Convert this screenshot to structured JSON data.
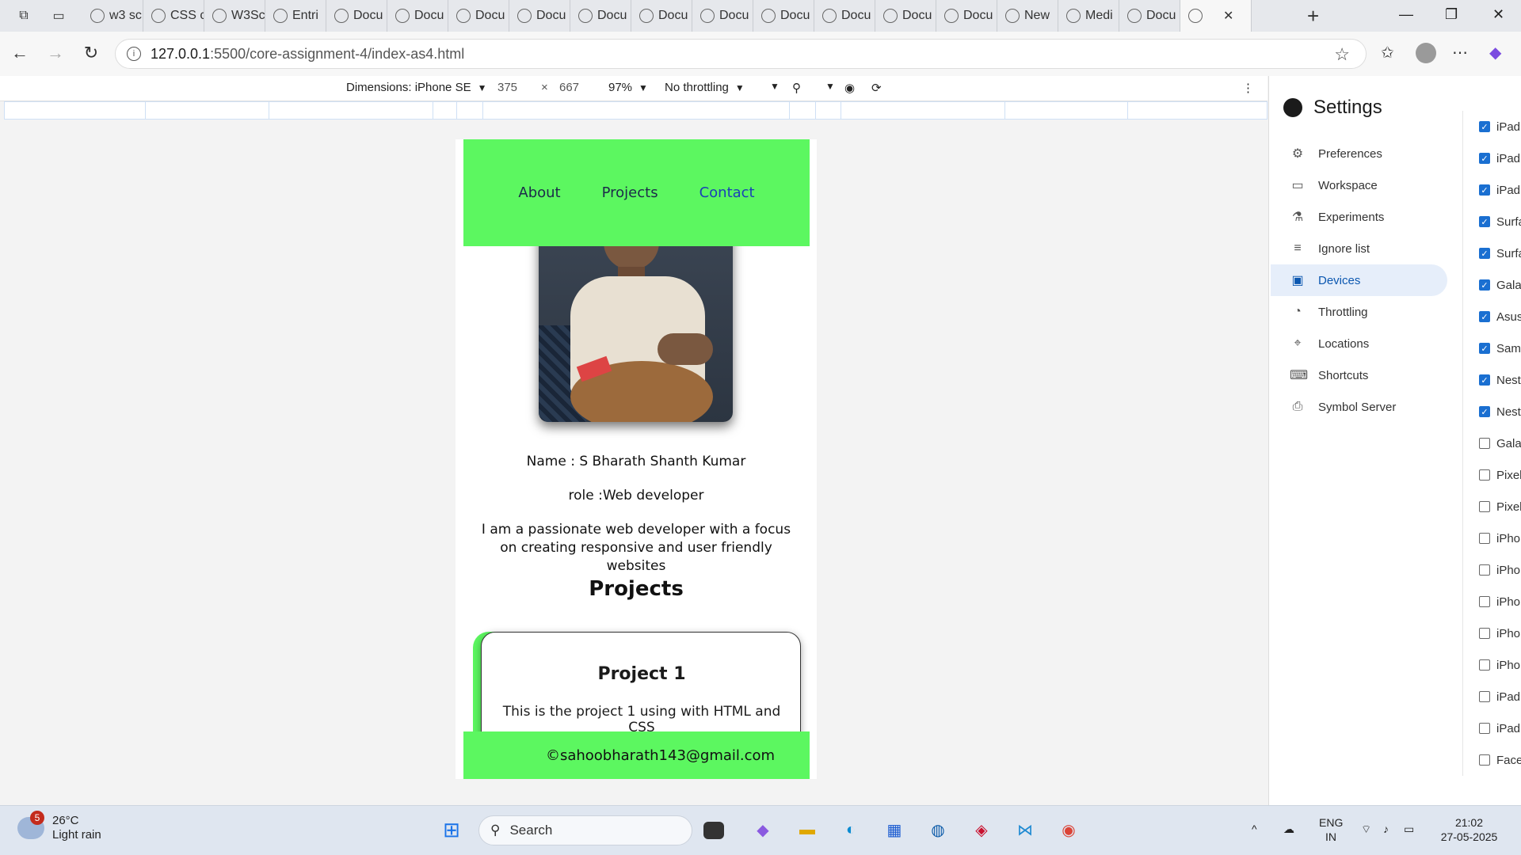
{
  "browser": {
    "tabs": [
      {
        "label": "w3 sc"
      },
      {
        "label": "CSS c"
      },
      {
        "label": "W3Sc"
      },
      {
        "label": "Entri"
      },
      {
        "label": "Docu"
      },
      {
        "label": "Docu"
      },
      {
        "label": "Docu"
      },
      {
        "label": "Docu"
      },
      {
        "label": "Docu"
      },
      {
        "label": "Docu"
      },
      {
        "label": "Docu"
      },
      {
        "label": "Docu"
      },
      {
        "label": "Docu"
      },
      {
        "label": "Docu"
      },
      {
        "label": "Docu"
      },
      {
        "label": "New"
      },
      {
        "label": "Medi"
      },
      {
        "label": "Docu"
      },
      {
        "label": ""
      }
    ],
    "url_host": "127.0.0.1",
    "url_path": ":5500/core-assignment-4/index-as4.html"
  },
  "device_toolbar": {
    "dimensions": "Dimensions: iPhone SE",
    "width": "375",
    "times": "×",
    "height": "667",
    "zoom": "97%",
    "throttling": "No throttling"
  },
  "site": {
    "nav": [
      {
        "label": "About"
      },
      {
        "label": "Projects"
      },
      {
        "label": "Contact"
      }
    ],
    "name": "Name : S Bharath Shanth Kumar",
    "role": "role :Web developer",
    "bio": "I am a passionate web developer with a focus on creating responsive and user friendly websites",
    "projects_heading": "Projects",
    "card_title": "Project 1",
    "card_body": "This is the project 1 using with HTML and CSS",
    "footer": "©sahoobharath143@gmail.com",
    "accent_color": "#5cf760"
  },
  "settings": {
    "title": "Settings",
    "menu": [
      {
        "label": "Preferences",
        "icon": "gear-icon"
      },
      {
        "label": "Workspace",
        "icon": "folder-icon"
      },
      {
        "label": "Experiments",
        "icon": "flask-icon"
      },
      {
        "label": "Ignore list",
        "icon": "ignore-list-icon"
      },
      {
        "label": "Devices",
        "icon": "devices-icon",
        "active": true
      },
      {
        "label": "Throttling",
        "icon": "gauge-icon"
      },
      {
        "label": "Locations",
        "icon": "location-pin-icon"
      },
      {
        "label": "Shortcuts",
        "icon": "keyboard-icon"
      },
      {
        "label": "Symbol Server",
        "icon": "symbol-server-icon"
      }
    ],
    "devices": [
      {
        "label": "iPad",
        "checked": true
      },
      {
        "label": "iPad",
        "checked": true
      },
      {
        "label": "iPad",
        "checked": true
      },
      {
        "label": "Surfa",
        "checked": true
      },
      {
        "label": "Surfa",
        "checked": true
      },
      {
        "label": "Gala",
        "checked": true
      },
      {
        "label": "Asus",
        "checked": true
      },
      {
        "label": "Sam",
        "checked": true
      },
      {
        "label": "Nest",
        "checked": true
      },
      {
        "label": "Nest",
        "checked": true
      },
      {
        "label": "Gala",
        "checked": false
      },
      {
        "label": "Pixel",
        "checked": false
      },
      {
        "label": "Pixel",
        "checked": false
      },
      {
        "label": "iPho",
        "checked": false
      },
      {
        "label": "iPho",
        "checked": false
      },
      {
        "label": "iPho",
        "checked": false
      },
      {
        "label": "iPho",
        "checked": false
      },
      {
        "label": "iPho",
        "checked": false
      },
      {
        "label": "iPad",
        "checked": false
      },
      {
        "label": "iPad",
        "checked": false
      },
      {
        "label": "Face",
        "checked": false
      }
    ]
  },
  "taskbar": {
    "weather_temp": "26°C",
    "weather_desc": "Light rain",
    "weather_badge": "5",
    "search_placeholder": "Search",
    "lang_top": "ENG",
    "lang_bottom": "IN",
    "time": "21:02",
    "date": "27-05-2025"
  }
}
